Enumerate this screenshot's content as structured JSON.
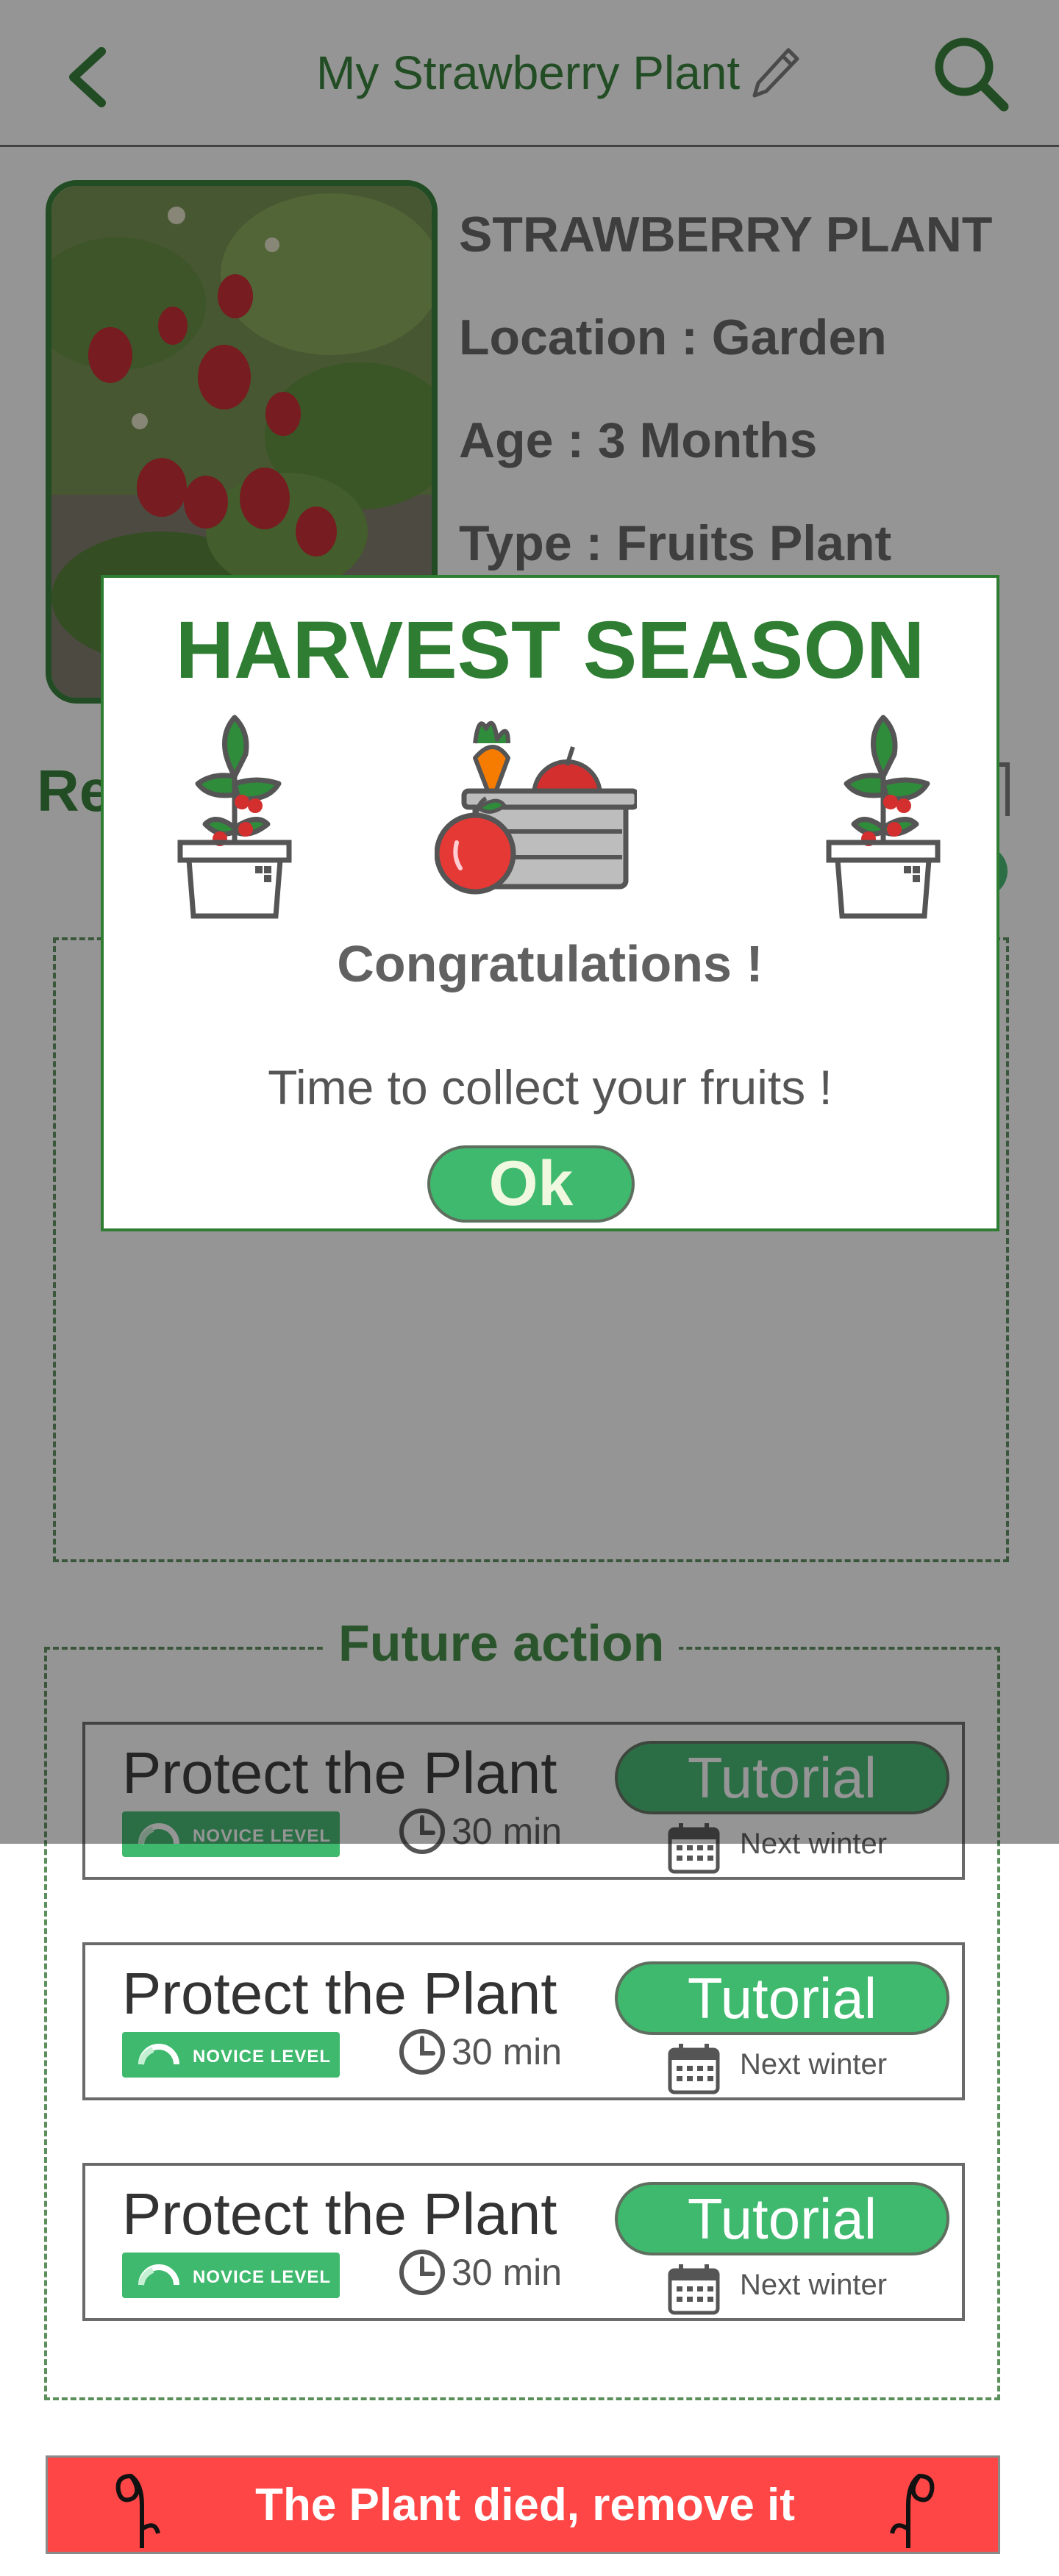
{
  "header": {
    "title": "My Strawberry Plant"
  },
  "plant": {
    "name": "STRAWBERRY PLANT",
    "location": "Location : Garden",
    "age": "Age : 3 Months",
    "type": "Type : Fruits Plant"
  },
  "sections": {
    "partial_title": "Re"
  },
  "future": {
    "title": "Future action",
    "cards": [
      {
        "title": "Protect the Plant",
        "level": "NOVICE LEVEL",
        "duration": "30 min",
        "button": "Tutorial",
        "when": "Next winter"
      },
      {
        "title": "Protect the Plant",
        "level": "NOVICE LEVEL",
        "duration": "30 min",
        "button": "Tutorial",
        "when": "Next winter"
      },
      {
        "title": "Protect the Plant",
        "level": "NOVICE LEVEL",
        "duration": "30 min",
        "button": "Tutorial",
        "when": "Next winter"
      }
    ]
  },
  "remove": {
    "label": "The Plant died, remove it"
  },
  "modal": {
    "title": "HARVEST SEASON",
    "congrats": "Congratulations !",
    "message": "Time to collect your fruits !",
    "ok": "Ok"
  },
  "colors": {
    "green": "#2e7d32",
    "accent": "#3fb96d",
    "danger": "#ff4646",
    "text": "#616161"
  },
  "icons": [
    "back-icon",
    "pencil-icon",
    "search-icon",
    "clock-icon",
    "calendar-icon",
    "wilted-plant-icon",
    "potted-plant-icon",
    "harvest-basket-icon"
  ]
}
